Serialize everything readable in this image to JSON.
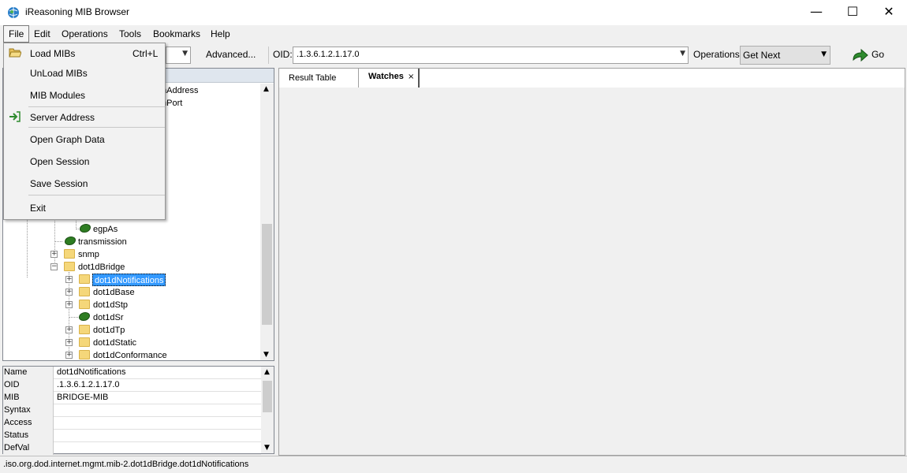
{
  "window": {
    "title": "iReasoning MIB Browser",
    "controls": {
      "minimize": "—",
      "maximize": "☐",
      "close": "✕"
    }
  },
  "menubar": [
    "File",
    "Edit",
    "Operations",
    "Tools",
    "Bookmarks",
    "Help"
  ],
  "toolbar": {
    "advanced_label": "Advanced...",
    "oid_label": "OID:",
    "oid_value": ".1.3.6.1.2.1.17.0",
    "operations_label": "Operations:",
    "operations_value": "Get Next",
    "go_label": "Go"
  },
  "file_menu": {
    "items": [
      {
        "label": "Load MIBs",
        "shortcut": "Ctrl+L",
        "icon": "folder-open-icon"
      },
      {
        "label": "UnLoad MIBs"
      },
      {
        "label": "MIB Modules"
      },
      {
        "label": "Server Address",
        "icon": "enter-arrow-icon"
      },
      {
        "label": "Open Graph Data"
      },
      {
        "label": "Open Session"
      },
      {
        "label": "Save Session"
      },
      {
        "label": "Exit"
      }
    ]
  },
  "tree": {
    "partial_top": [
      "mAddress",
      "mPort"
    ],
    "nodes": [
      {
        "label": "egpAs",
        "type": "leaf"
      },
      {
        "label": "transmission",
        "type": "leaf"
      },
      {
        "label": "snmp",
        "type": "folder",
        "expand": "+"
      },
      {
        "label": "dot1dBridge",
        "type": "folder",
        "expand": "−"
      },
      {
        "label": "dot1dNotifications",
        "type": "folder",
        "expand": "+",
        "selected": true
      },
      {
        "label": "dot1dBase",
        "type": "folder",
        "expand": "+"
      },
      {
        "label": "dot1dStp",
        "type": "folder",
        "expand": "+"
      },
      {
        "label": "dot1dSr",
        "type": "leaf"
      },
      {
        "label": "dot1dTp",
        "type": "folder",
        "expand": "+"
      },
      {
        "label": "dot1dStatic",
        "type": "folder",
        "expand": "+"
      },
      {
        "label": "dot1dConformance",
        "type": "folder",
        "expand": "+"
      }
    ]
  },
  "properties": [
    {
      "key": "Name",
      "value": "dot1dNotifications"
    },
    {
      "key": "OID",
      "value": ".1.3.6.1.2.1.17.0"
    },
    {
      "key": "MIB",
      "value": "BRIDGE-MIB"
    },
    {
      "key": "Syntax",
      "value": ""
    },
    {
      "key": "Access",
      "value": ""
    },
    {
      "key": "Status",
      "value": ""
    },
    {
      "key": "DefVal",
      "value": ""
    }
  ],
  "tabs": [
    {
      "label": "Result Table"
    },
    {
      "label": "Watches",
      "close": "×"
    }
  ],
  "status": ".iso.org.dod.internet.mgmt.mib-2.dot1dBridge.dot1dNotifications",
  "colors": {
    "selection": "#3399ff",
    "folder": "#f5d77a",
    "leaf": "#2e7d22"
  }
}
